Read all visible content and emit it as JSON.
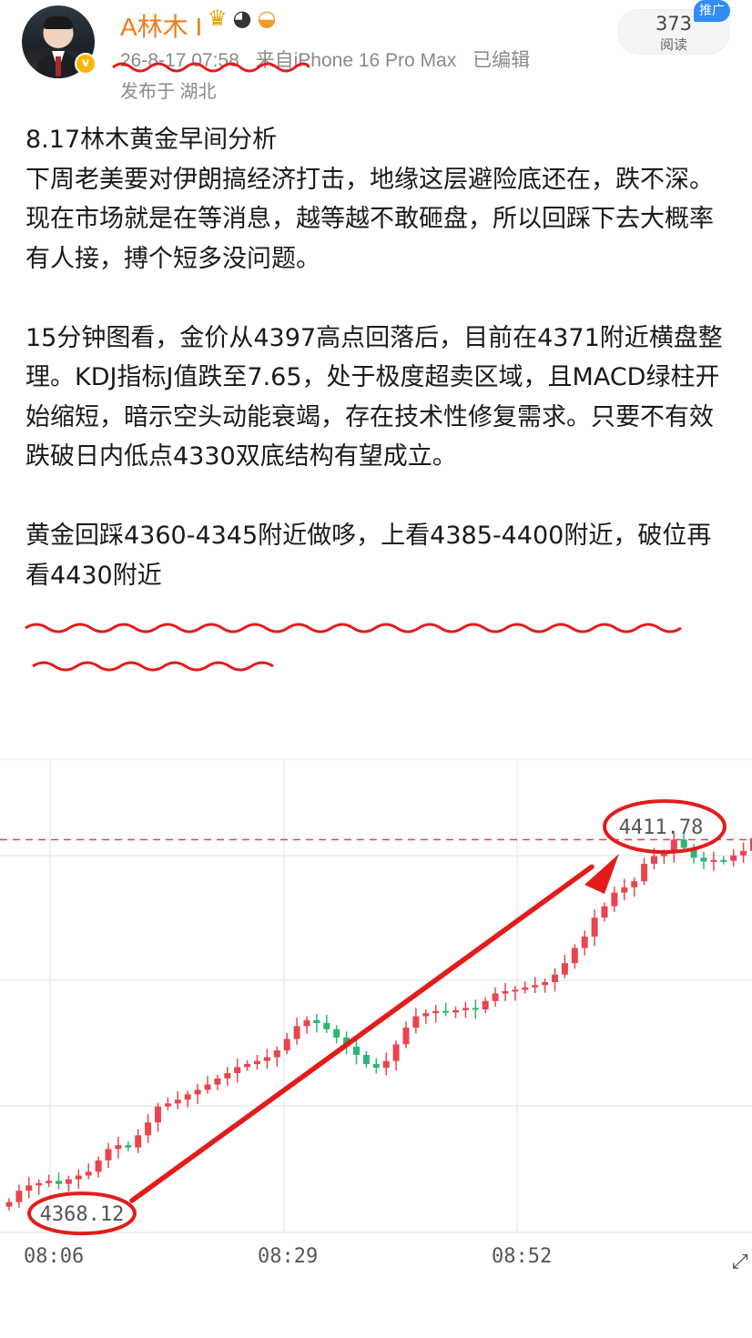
{
  "header": {
    "username": "A林木",
    "username_separator": "I",
    "badges": [
      "crown-icon",
      "panda-icon",
      "fish-icon"
    ],
    "verified_mark": "v",
    "post_time": "26-8-17 07:58",
    "source": "来自iPhone 16 Pro Max",
    "edited": "已编辑",
    "location": "发布于 湖北",
    "read_count": "373",
    "read_label": "阅读",
    "promo_tag": "推广"
  },
  "post": {
    "line1": "8.17林木黄金早间分析",
    "para1": "下周老美要对伊朗搞经济打击，地缘这层避险底还在，跌不深。",
    "para2": "现在市场就是在等消息，越等越不敢砸盘，所以回踩下去大概率有人接，搏个短多没问题。",
    "para3": "15分钟图看，金价从4397高点回落后，目前在4371附近横盘整理。KDJ指标J值跌至7.65，处于极度超卖区域，且MACD绿柱开始缩短，暗示空头动能衰竭，存在技术性修复需求。只要不有效跌破日内低点4330双底结构有望成立。",
    "para4": "黄金回踩4360-4345附近做哆，上看4385-4400附近，破位再看4430附近"
  },
  "chart_data": {
    "type": "candlestick",
    "title": "",
    "x_ticks": [
      "08:06",
      "08:29",
      "08:52"
    ],
    "annotations": [
      {
        "label": "4368.12",
        "role": "low"
      },
      {
        "label": "4411.78",
        "role": "high"
      }
    ],
    "price_line": 4411.78,
    "ylim": [
      4360,
      4420
    ],
    "colors": {
      "up": "#e8464f",
      "down": "#2bb673",
      "price_line": "#e8464f",
      "annotation": "#e41b1b"
    }
  }
}
